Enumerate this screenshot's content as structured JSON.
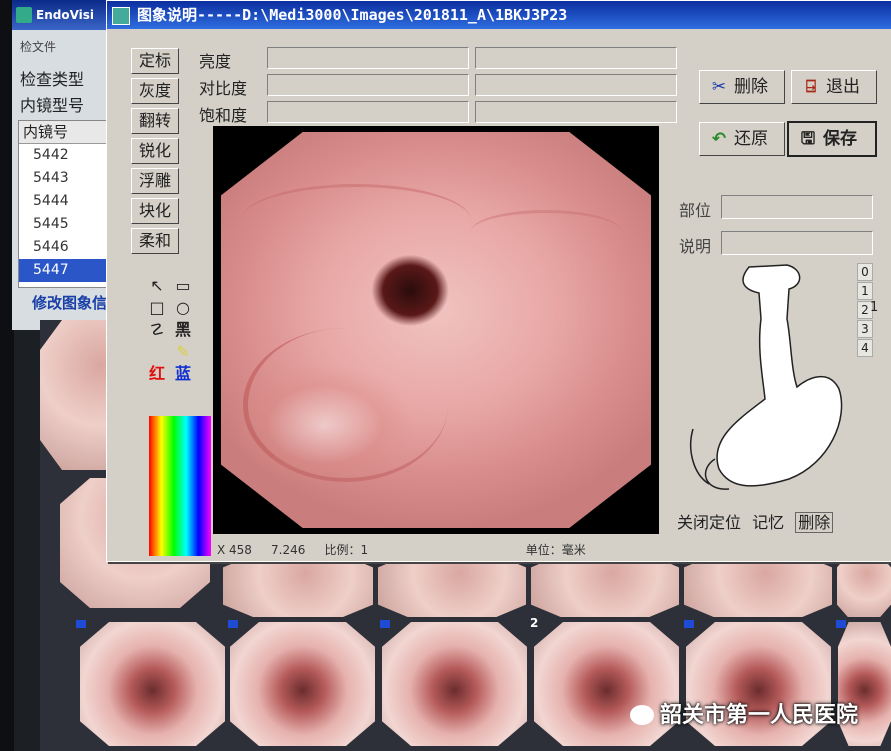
{
  "background_app": {
    "title": "EndoVisi",
    "menu_partial": "检文件",
    "exam_type_label": "检查类型",
    "scope_model_label": "内镜型号",
    "scope_list": {
      "header": "内镜号",
      "rows": [
        "5442",
        "5443",
        "5444",
        "5445",
        "5446",
        "5447"
      ],
      "selected_index": 5
    },
    "edit_link": "修改图象信"
  },
  "dialog": {
    "title": "图象说明-----D:\\Medi3000\\Images\\201811_A\\1BKJ3P23",
    "left_buttons": [
      "定标",
      "灰度",
      "翻转",
      "锐化",
      "浮雕",
      "块化",
      "柔和"
    ],
    "sliders": {
      "brightness_label": "亮度",
      "contrast_label": "对比度",
      "saturation_label": "饱和度"
    },
    "actions": {
      "delete": "删除",
      "exit": "退出",
      "restore": "还原",
      "save": "保存"
    },
    "tools": {
      "arrow": "↖",
      "rounded_rect": "▭",
      "rect": "□",
      "circle": "○",
      "freeform": "☡",
      "black": "黑",
      "red": "红",
      "blue": "蓝"
    },
    "colors": {
      "red": "#e01010",
      "blue": "#1030d0",
      "title_bar": "#0b2ea0"
    },
    "status": {
      "x": "X 458",
      "y": "7.246",
      "scale": "比例：1",
      "unit": "单位：毫米"
    },
    "info": {
      "location_label": "部位",
      "description_label": "说明"
    },
    "diagram_numbers": [
      "0",
      "1",
      "2",
      "3",
      "4"
    ],
    "bottom_actions": {
      "close_locate": "关闭定位",
      "remember": "记忆",
      "delete": "删除"
    }
  },
  "thumbnail_grid": {
    "second_row_label": "2"
  },
  "watermark": "韶关市第一人民医院"
}
